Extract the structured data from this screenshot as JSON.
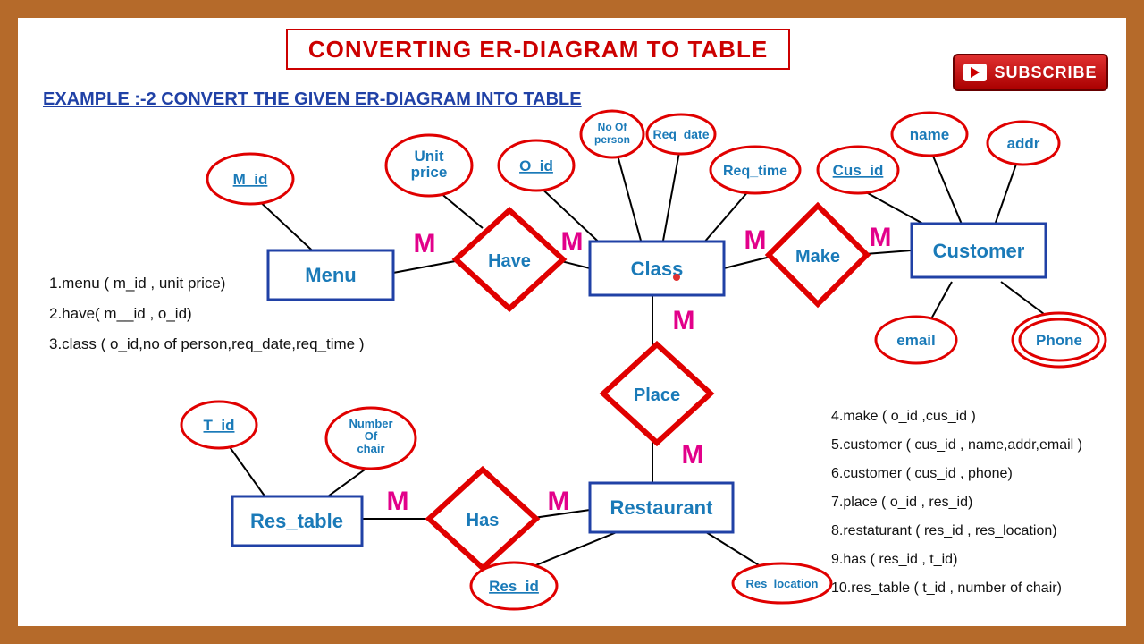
{
  "title": "CONVERTING ER-DIAGRAM TO TABLE",
  "subscribe_label": "SUBSCRIBE",
  "example_heading": "EXAMPLE :-2    CONVERT THE  GIVEN ER-DIAGRAM INTO TABLE",
  "entities": {
    "menu": "Menu",
    "class": "Class",
    "customer": "Customer",
    "res_table": "Res_table",
    "restaurant": "Restaurant"
  },
  "relationships": {
    "have": "Have",
    "make": "Make",
    "place": "Place",
    "has": "Has"
  },
  "attributes": {
    "m_id": "M_id",
    "unit_price": "Unit price",
    "o_id": "O_id",
    "no_of_person": "No Of person",
    "req_date": "Req_date",
    "req_time": "Req_time",
    "cus_id": "Cus_id",
    "name": "name",
    "addr": "addr",
    "email": "email",
    "phone": "Phone",
    "t_id": "T_id",
    "num_chair": "Number Of chair",
    "res_id": "Res_id",
    "res_location": "Res_location"
  },
  "cardinality": "M",
  "tables_left": {
    "l1": "1.menu ( m_id , unit price)",
    "l2": "2.have( m__id   , o_id)",
    "l3": "3.class ( o_id,no of person,req_date,req_time )"
  },
  "tables_right": {
    "r4": "4.make ( o_id ,cus_id )",
    "r5": "5.customer ( cus_id , name,addr,email )",
    "r6": "6.customer ( cus_id , phone)",
    "r7": "7.place ( o_id , res_id)",
    "r8": "8.restaturant ( res_id , res_location)",
    "r9": "9.has ( res_id , t_id)",
    "r10": "10.res_table ( t_id  , number of chair)"
  }
}
